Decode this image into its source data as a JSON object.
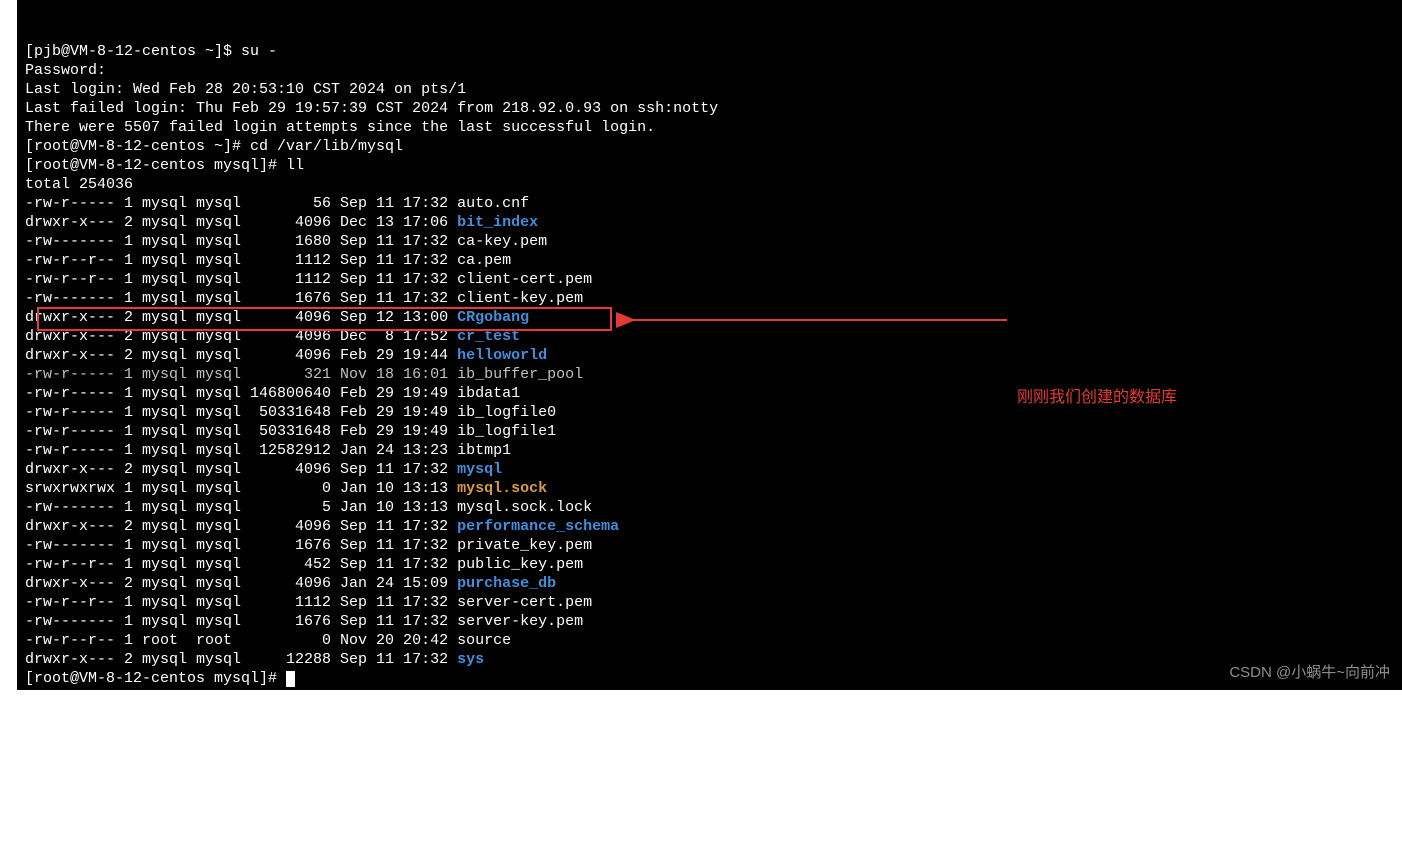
{
  "terminal": {
    "lines": [
      {
        "segs": [
          {
            "t": "[pjb@VM-8-12-centos ~]$ su -"
          }
        ]
      },
      {
        "segs": [
          {
            "t": "Password:"
          }
        ]
      },
      {
        "segs": [
          {
            "t": "Last login: Wed Feb 28 20:53:10 CST 2024 on pts/1"
          }
        ]
      },
      {
        "segs": [
          {
            "t": "Last failed login: Thu Feb 29 19:57:39 CST 2024 from 218.92.0.93 on ssh:notty"
          }
        ]
      },
      {
        "segs": [
          {
            "t": "There were 5507 failed login attempts since the last successful login."
          }
        ]
      },
      {
        "segs": [
          {
            "t": "[root@VM-8-12-centos ~]# cd /var/lib/mysql"
          }
        ]
      },
      {
        "segs": [
          {
            "t": "[root@VM-8-12-centos mysql]# ll"
          }
        ]
      },
      {
        "segs": [
          {
            "t": "total 254036"
          }
        ]
      },
      {
        "segs": [
          {
            "t": "-rw-r----- 1 mysql mysql        56 Sep 11 17:32 auto.cnf"
          }
        ]
      },
      {
        "segs": [
          {
            "t": "drwxr-x--- 2 mysql mysql      4096 Dec 13 17:06 "
          },
          {
            "t": "bit_index",
            "cls": "dir"
          }
        ]
      },
      {
        "segs": [
          {
            "t": "-rw------- 1 mysql mysql      1680 Sep 11 17:32 ca-key.pem"
          }
        ]
      },
      {
        "segs": [
          {
            "t": "-rw-r--r-- 1 mysql mysql      1112 Sep 11 17:32 ca.pem"
          }
        ]
      },
      {
        "segs": [
          {
            "t": "-rw-r--r-- 1 mysql mysql      1112 Sep 11 17:32 client-cert.pem"
          }
        ]
      },
      {
        "segs": [
          {
            "t": "-rw------- 1 mysql mysql      1676 Sep 11 17:32 client-key.pem"
          }
        ]
      },
      {
        "segs": [
          {
            "t": "drwxr-x--- 2 mysql mysql      4096 Sep 12 13:00 "
          },
          {
            "t": "CRgobang",
            "cls": "dir"
          }
        ]
      },
      {
        "segs": [
          {
            "t": "drwxr-x--- 2 mysql mysql      4096 Dec  8 17:52 "
          },
          {
            "t": "cr_test",
            "cls": "dir"
          }
        ]
      },
      {
        "segs": [
          {
            "t": "drwxr-x--- 2 mysql mysql      4096 Feb 29 19:44 "
          },
          {
            "t": "helloworld",
            "cls": "dir"
          }
        ]
      },
      {
        "segs": [
          {
            "t": "-rw-r----- 1 mysql mysql       321 Nov 18 16:01 ib_buffer_pool",
            "cls": "dim"
          }
        ]
      },
      {
        "segs": [
          {
            "t": "-rw-r----- 1 mysql mysql 146800640 Feb 29 19:49 ibdata1"
          }
        ]
      },
      {
        "segs": [
          {
            "t": "-rw-r----- 1 mysql mysql  50331648 Feb 29 19:49 ib_logfile0"
          }
        ]
      },
      {
        "segs": [
          {
            "t": "-rw-r----- 1 mysql mysql  50331648 Feb 29 19:49 ib_logfile1"
          }
        ]
      },
      {
        "segs": [
          {
            "t": "-rw-r----- 1 mysql mysql  12582912 Jan 24 13:23 ibtmp1"
          }
        ]
      },
      {
        "segs": [
          {
            "t": "drwxr-x--- 2 mysql mysql      4096 Sep 11 17:32 "
          },
          {
            "t": "mysql",
            "cls": "dir"
          }
        ]
      },
      {
        "segs": [
          {
            "t": "srwxrwxrwx 1 mysql mysql         0 Jan 10 13:13 "
          },
          {
            "t": "mysql.sock",
            "cls": "sock"
          }
        ]
      },
      {
        "segs": [
          {
            "t": "-rw------- 1 mysql mysql         5 Jan 10 13:13 mysql.sock.lock"
          }
        ]
      },
      {
        "segs": [
          {
            "t": "drwxr-x--- 2 mysql mysql      4096 Sep 11 17:32 "
          },
          {
            "t": "performance_schema",
            "cls": "dir"
          }
        ]
      },
      {
        "segs": [
          {
            "t": "-rw------- 1 mysql mysql      1676 Sep 11 17:32 private_key.pem"
          }
        ]
      },
      {
        "segs": [
          {
            "t": "-rw-r--r-- 1 mysql mysql       452 Sep 11 17:32 public_key.pem"
          }
        ]
      },
      {
        "segs": [
          {
            "t": "drwxr-x--- 2 mysql mysql      4096 Jan 24 15:09 "
          },
          {
            "t": "purchase_db",
            "cls": "dir"
          }
        ]
      },
      {
        "segs": [
          {
            "t": "-rw-r--r-- 1 mysql mysql      1112 Sep 11 17:32 server-cert.pem"
          }
        ]
      },
      {
        "segs": [
          {
            "t": "-rw------- 1 mysql mysql      1676 Sep 11 17:32 server-key.pem"
          }
        ]
      },
      {
        "segs": [
          {
            "t": "-rw-r--r-- 1 root  root          0 Nov 20 20:42 source"
          }
        ]
      },
      {
        "segs": [
          {
            "t": "drwxr-x--- 2 mysql mysql     12288 Sep 11 17:32 "
          },
          {
            "t": "sys",
            "cls": "dir"
          }
        ]
      },
      {
        "segs": [
          {
            "t": "[root@VM-8-12-centos mysql]# "
          }
        ],
        "cursor": true
      }
    ]
  },
  "annotation_text": "刚刚我们创建的数据库",
  "watermark_text": "CSDN @小蜗牛~向前冲"
}
